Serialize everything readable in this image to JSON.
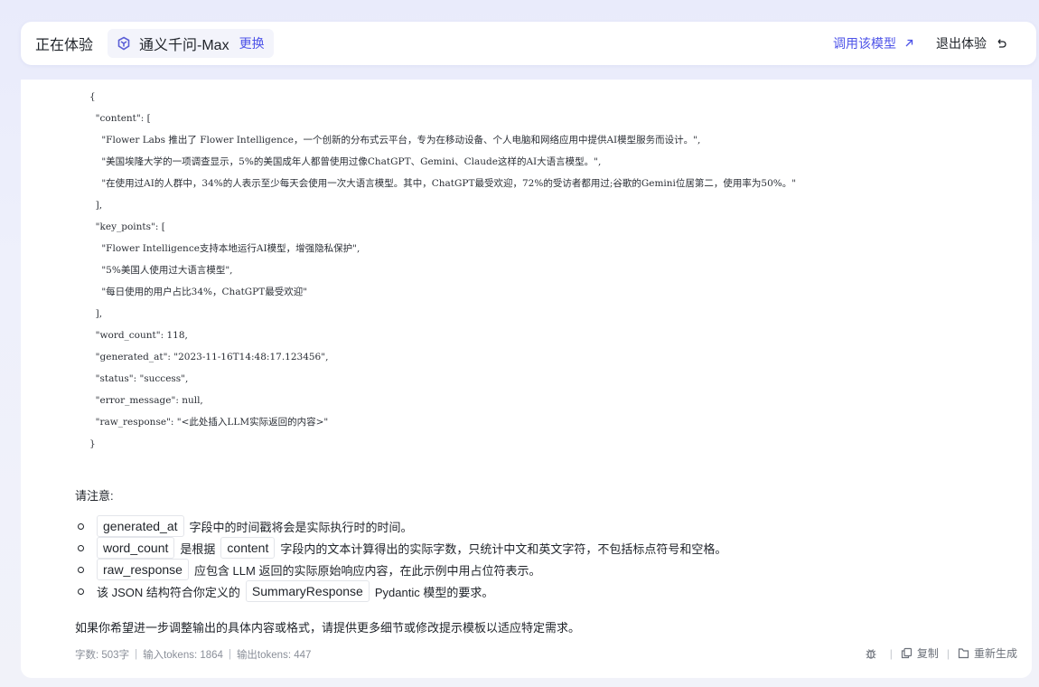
{
  "header": {
    "title": "正在体验",
    "model_name": "通义千问-Max",
    "switch_label": "更换",
    "call_model_label": "调用该模型",
    "exit_label": "退出体验"
  },
  "code_lines": [
    "{",
    "  \"content\": [",
    "    \"Flower Labs 推出了 Flower Intelligence，一个创新的分布式云平台，专为在移动设备、个人电脑和网络应用中提供AI模型服务而设计。\",",
    "    \"美国埃隆大学的一项调查显示，5%的美国成年人都曾使用过像ChatGPT、Gemini、Claude这样的AI大语言模型。\",",
    "    \"在使用过AI的人群中，34%的人表示至少每天会使用一次大语言模型。其中，ChatGPT最受欢迎，72%的受访者都用过;谷歌的Gemini位居第二，使用率为50%。\"",
    "  ],",
    "  \"key_points\": [",
    "    \"Flower Intelligence支持本地运行AI模型，增强隐私保护\",",
    "    \"5%美国人使用过大语言模型\",",
    "    \"每日使用的用户占比34%，ChatGPT最受欢迎\"",
    "  ],",
    "  \"word_count\": 118,",
    "  \"generated_at\": \"2023-11-16T14:48:17.123456\",",
    "  \"status\": \"success\",",
    "  \"error_message\": null,",
    "  \"raw_response\": \"<此处插入LLM实际返回的内容>\"",
    "}"
  ],
  "notes": {
    "title": "请注意:",
    "b1": {
      "tag": "generated_at",
      "text": "字段中的时间戳将会是实际执行时的时间。"
    },
    "b2": {
      "tag": "word_count",
      "mid": "是根据",
      "tag2": "content",
      "text": "字段内的文本计算得出的实际字数，只统计中文和英文字符，不包括标点符号和空格。"
    },
    "b3": {
      "tag": "raw_response",
      "text": "应包含 LLM 返回的实际原始响应内容，在此示例中用占位符表示。"
    },
    "b4": {
      "pre": "该 JSON 结构符合你定义的",
      "tag": "SummaryResponse",
      "text": "Pydantic 模型的要求。"
    },
    "closing": "如果你希望进一步调整输出的具体内容或格式，请提供更多细节或修改提示模板以适应特定需求。"
  },
  "footer": {
    "word_count": "字数: 503字",
    "input_tokens": "输入tokens: 1864",
    "output_tokens": "输出tokens: 447",
    "copy_label": "复制",
    "regenerate_label": "重新生成"
  },
  "colors": {
    "accent": "#4d53e8",
    "muted": "#8a8f99"
  }
}
